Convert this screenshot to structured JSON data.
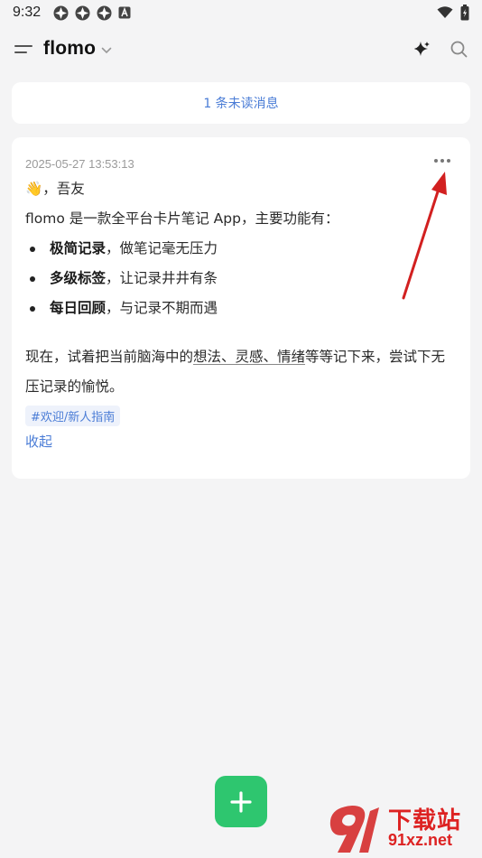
{
  "status_bar": {
    "time": "9:32"
  },
  "header": {
    "title": "flomo"
  },
  "unread_banner": {
    "text": "1 条未读消息"
  },
  "memo": {
    "timestamp": "2025-05-27 13:53:13",
    "greeting": "👋，吾友",
    "intro": "flomo 是一款全平台卡片笔记 App，主要功能有：",
    "features": [
      {
        "bold": "极简记录",
        "rest": "，做笔记毫无压力"
      },
      {
        "bold": "多级标签",
        "rest": "，让记录井井有条"
      },
      {
        "bold": "每日回顾",
        "rest": "，与记录不期而遇"
      }
    ],
    "paragraph_before": "现在，试着把当前脑海中的",
    "paragraph_underlined": "想法、灵感、情绪",
    "paragraph_after": "等等记下来，尝试下无压记录的愉悦。",
    "tag": "#欢迎/新人指南",
    "collapse_label": "收起"
  },
  "watermark": {
    "big": "下载站",
    "small": "91xz.net"
  },
  "colors": {
    "accent": "#4a7cd6",
    "fab": "#2ec66f",
    "annotation": "#d22020"
  }
}
